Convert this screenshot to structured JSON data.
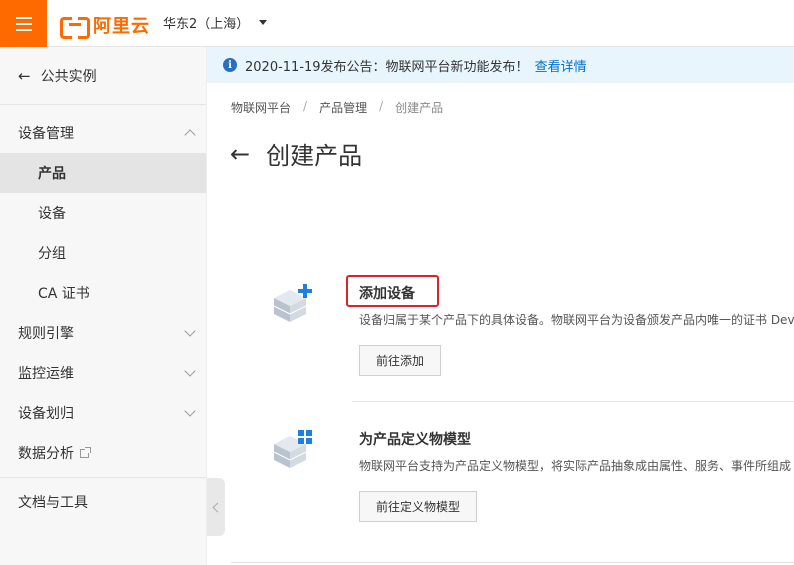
{
  "topbar": {
    "logo_text": "阿里云",
    "region": "华东2（上海）"
  },
  "sidebar": {
    "back_label": "公共实例",
    "items": [
      {
        "label": "设备管理"
      },
      {
        "label": "产品"
      },
      {
        "label": "设备"
      },
      {
        "label": "分组"
      },
      {
        "label": "CA 证书"
      },
      {
        "label": "规则引擎"
      },
      {
        "label": "监控运维"
      },
      {
        "label": "设备划归"
      },
      {
        "label": "数据分析"
      },
      {
        "label": "文档与工具"
      }
    ]
  },
  "notice": {
    "text": "2020-11-19发布公告：物联网平台新功能发布！",
    "link": "查看详情"
  },
  "breadcrumb": [
    "物联网平台",
    "产品管理",
    "创建产品"
  ],
  "page": {
    "title": "创建产品"
  },
  "steps": [
    {
      "name": "添加设备",
      "desc": "设备归属于某个产品下的具体设备。物联网平台为设备颁发产品内唯一的证书 Devi",
      "button": "前往添加"
    },
    {
      "name": "为产品定义物模型",
      "desc": "物联网平台支持为产品定义物模型，将实际产品抽象成由属性、服务、事件所组成",
      "button": "前往定义物模型"
    }
  ],
  "colors": {
    "brand": "#ff6a00",
    "link": "#0070cc",
    "highlight": "#d9232d",
    "notice_bg": "#e8f5fd"
  }
}
